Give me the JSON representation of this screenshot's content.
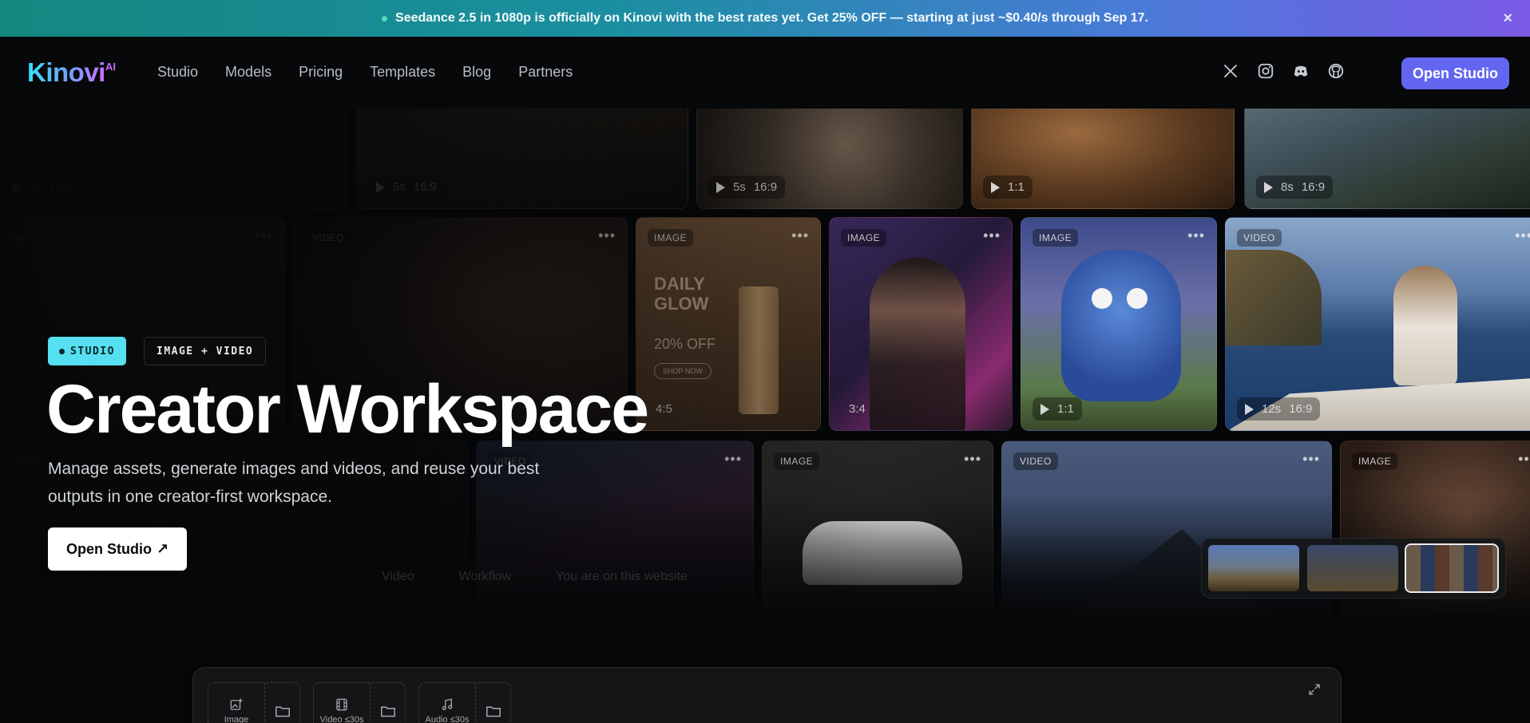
{
  "announcement": {
    "text": "Seedance 2.5 in 1080p is officially on Kinovi with the best rates yet. Get 25% OFF — starting at just ~$0.40/s through Sep 17.",
    "close": "×"
  },
  "brand": {
    "name": "Kinovi",
    "sup": "AI"
  },
  "nav": [
    "Studio",
    "Models",
    "Pricing",
    "Templates",
    "Blog",
    "Partners"
  ],
  "social": [
    "x-icon",
    "instagram-icon",
    "discord-icon",
    "github-icon"
  ],
  "header_cta": "Open Studio",
  "hero": {
    "chip_primary": "STUDIO",
    "chip_secondary": "IMAGE + VIDEO",
    "title": "Creator Workspace",
    "subtitle": "Manage assets, generate images and videos, and reuse your best outputs in one creator-first workspace.",
    "cta": "Open Studio",
    "cta_icon": "↗"
  },
  "ghost_tabs": [
    "Video",
    "Workflow",
    "You are on this website"
  ],
  "tiles": {
    "top_row": [
      {
        "duration": "5s",
        "ratio": "16:9"
      },
      {
        "duration": "5s",
        "ratio": "16:9"
      },
      {
        "duration": "5s",
        "ratio": "16:9"
      },
      {
        "ratio": "1:1"
      },
      {
        "duration": "8s",
        "ratio": "16:9"
      }
    ],
    "mid_row": [
      {
        "tag": "IMAGE"
      },
      {
        "tag": "VIDEO"
      },
      {
        "tag": "IMAGE",
        "ratio": "4:5",
        "ad_title_1": "DAILY",
        "ad_title_2": "GLOW",
        "ad_offer": "20% OFF",
        "ad_button": "SHOP NOW"
      },
      {
        "tag": "IMAGE",
        "ratio": "3:4"
      },
      {
        "tag": "IMAGE",
        "ratio": "1:1"
      },
      {
        "tag": "VIDEO",
        "duration": "12s",
        "ratio": "16:9"
      }
    ],
    "bottom_row": [
      {
        "tag": "IMAGE"
      },
      {
        "tag": "VIDEO"
      },
      {
        "tag": "IMAGE"
      },
      {
        "tag": "VIDEO"
      },
      {
        "tag": "IMAGE"
      }
    ],
    "more": "•••"
  },
  "composer": {
    "attachments": [
      {
        "label": "Image",
        "icon": "image-plus-icon"
      },
      {
        "label": "Video ≤30s",
        "icon": "film-icon"
      },
      {
        "label": "Audio ≤30s",
        "icon": "music-note-icon"
      }
    ]
  }
}
